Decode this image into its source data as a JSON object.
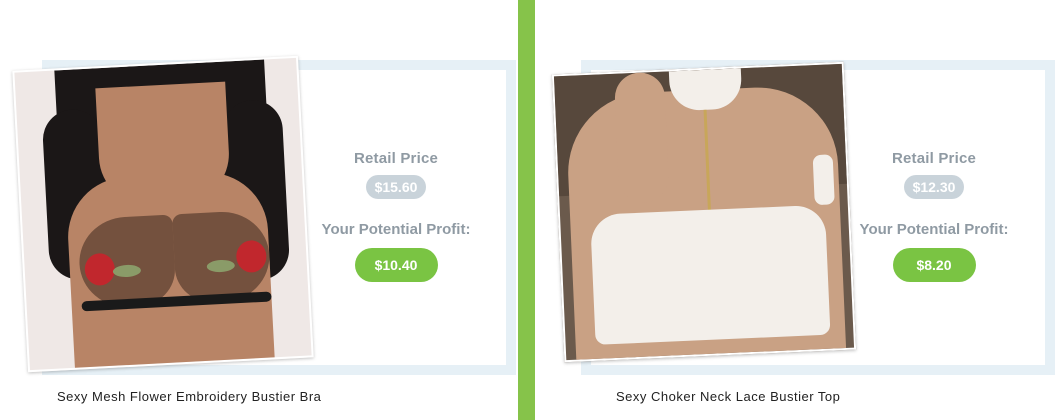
{
  "products": [
    {
      "title": "Sexy Mesh Flower Embroidery Bustier Bra",
      "retail_label": "Retail Price",
      "retail_price": "$15.60",
      "profit_label": "Your Potential Profit:",
      "profit": "$10.40"
    },
    {
      "title": "Sexy Choker Neck Lace Bustier Top",
      "retail_label": "Retail Price",
      "retail_price": "$12.30",
      "profit_label": "Your Potential Profit:",
      "profit": "$8.20"
    }
  ],
  "colors": {
    "accent_green": "#7ac443",
    "divider_green": "#86c34a",
    "frame_blue": "#e6f0f6",
    "retail_pill": "#c9d3da",
    "label_gray": "#8f9aa3"
  }
}
